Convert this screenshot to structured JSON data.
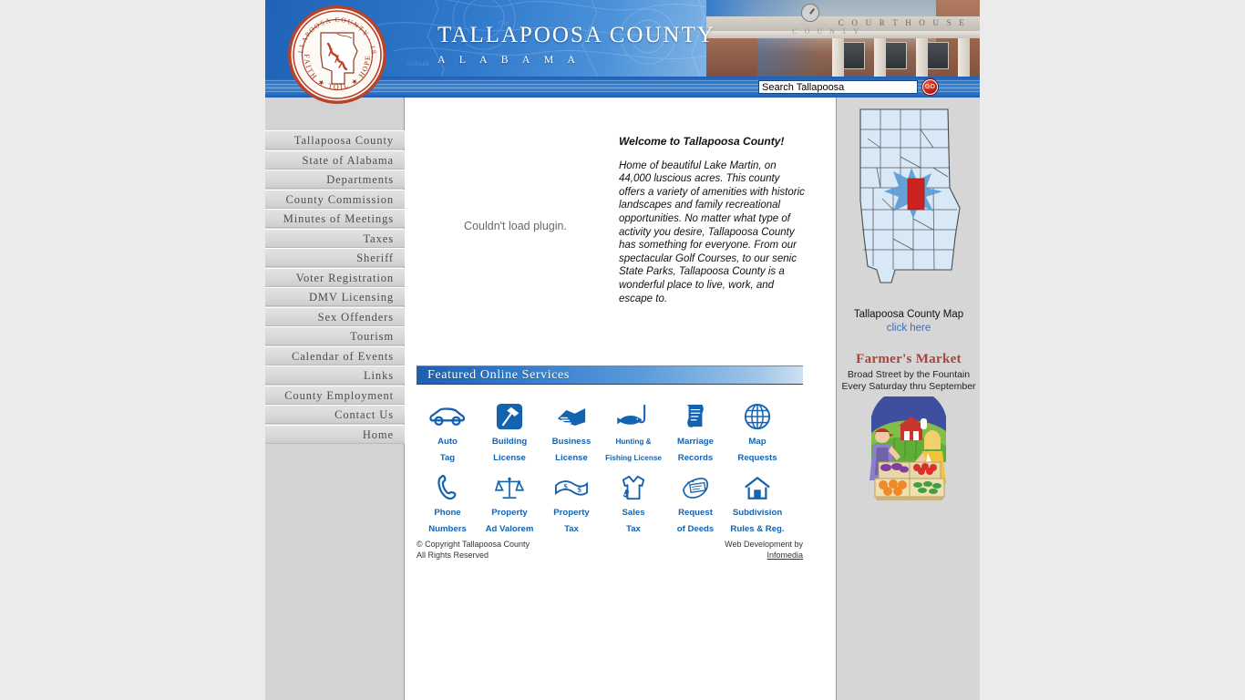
{
  "header": {
    "title_main": "TALLAPOOSA COUNTY",
    "title_sub": "A L A B A M A",
    "seal": {
      "top_text": "TALLAPOOSA COUNTY · 1832",
      "bottom_text": "FAITH ★ TOIL ★ HOPE",
      "icon": "county-seal-icon"
    },
    "photo": {
      "courthouse_word": "C O U R T H O U S E",
      "county_word": "C O U N T Y",
      "icon": "courthouse-photo"
    }
  },
  "search": {
    "value": "Search Tallapoosa",
    "placeholder": "Search Tallapoosa",
    "go_label": "GO",
    "go_icon": "go-button-icon"
  },
  "sidebar": {
    "items": [
      {
        "label": "Tallapoosa County"
      },
      {
        "label": "State of Alabama"
      },
      {
        "label": "Departments"
      },
      {
        "label": "County Commission"
      },
      {
        "label": "Minutes of Meetings"
      },
      {
        "label": "Taxes"
      },
      {
        "label": "Sheriff"
      },
      {
        "label": "Voter Registration"
      },
      {
        "label": "DMV Licensing"
      },
      {
        "label": "Sex Offenders"
      },
      {
        "label": "Tourism"
      },
      {
        "label": "Calendar of Events"
      },
      {
        "label": "Links"
      },
      {
        "label": "County Employment"
      },
      {
        "label": "Contact Us"
      },
      {
        "label": "Home"
      }
    ]
  },
  "main": {
    "plugin_message": "Couldn't load plugin.",
    "welcome_title": "Welcome to Tallapoosa County!",
    "welcome_body": "Home of beautiful Lake Martin, on 44,000 luscious acres. This county offers a variety of amenities with historic landscapes and family recreational opportunities. No matter what type of activity you desire, Tallapoosa County has something for everyone.  From our spectacular Golf Courses, to our senic State Parks, Tallapoosa County is a wonderful place to live, work, and escape to.",
    "services_heading": "Featured Online Services",
    "services": [
      {
        "label": "Auto\nTag",
        "icon": "car-icon",
        "small": false
      },
      {
        "label": "Building\nLicense",
        "icon": "hammer-icon",
        "small": false
      },
      {
        "label": "Business\nLicense",
        "icon": "handshake-icon",
        "small": false
      },
      {
        "label": "Hunting &\nFishing License",
        "icon": "fish-hook-icon",
        "small": true
      },
      {
        "label": "Marriage\nRecords",
        "icon": "certificate-icon",
        "small": false
      },
      {
        "label": "Map\nRequests",
        "icon": "globe-icon",
        "small": false
      },
      {
        "label": "Phone\nNumbers",
        "icon": "telephone-handset-icon",
        "small": false
      },
      {
        "label": "Property\nAd Valorem",
        "icon": "scales-icon",
        "small": false
      },
      {
        "label": "Property\nTax",
        "icon": "money-icon",
        "small": false
      },
      {
        "label": "Sales\nTax",
        "icon": "shirt-tag-icon",
        "small": false
      },
      {
        "label": "Request\nof Deeds",
        "icon": "deed-document-icon",
        "small": false
      },
      {
        "label": "Subdivision\nRules & Reg.",
        "icon": "house-icon",
        "small": false
      }
    ]
  },
  "footer": {
    "copyright_line1": "© Copyright Tallapoosa County",
    "copyright_line2": "All Rights Reserved",
    "webdev_line1": "Web Development by",
    "webdev_link": "Infomedia"
  },
  "right_panel": {
    "map": {
      "icon": "alabama-county-map",
      "caption": "Tallapoosa County Map",
      "link_label": "click here",
      "highlight_color": "#cc2222",
      "star_color": "#5b9bd5",
      "county_fill": "#d8e8f7"
    },
    "farmers_market": {
      "title": "Farmer's Market",
      "line1": "Broad Street by the Fountain",
      "line2": "Every Saturday thru September",
      "icon": "farmers-market-illustration",
      "title_color": "#a8443c"
    }
  }
}
